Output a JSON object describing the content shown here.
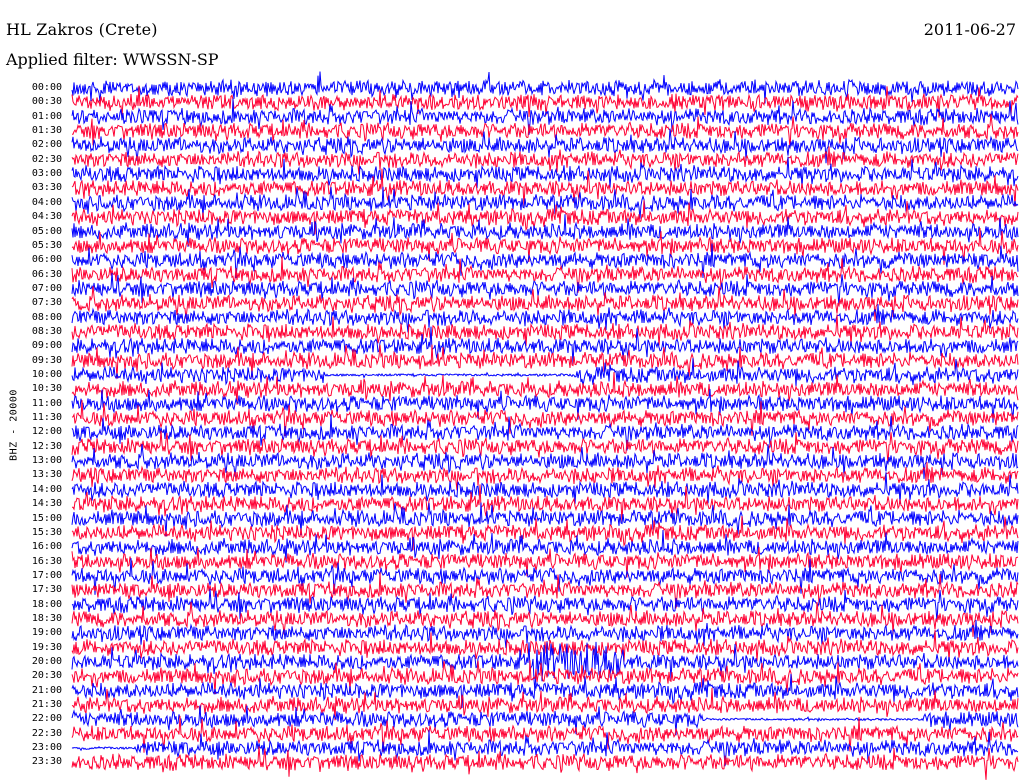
{
  "header": {
    "station": "HL Zakros (Crete)",
    "date": "2011-06-27",
    "filter": "Applied filter: WWSSN-SP"
  },
  "channel_label": "BHZ - 20000",
  "chart_data": {
    "type": "line",
    "subtype": "helicorder",
    "trace_colors": [
      "#0000ff",
      "#ff0033"
    ],
    "row_labels": [
      "00:00",
      "00:30",
      "01:00",
      "01:30",
      "02:00",
      "02:30",
      "03:00",
      "03:30",
      "04:00",
      "04:30",
      "05:00",
      "05:30",
      "06:00",
      "06:30",
      "07:00",
      "07:30",
      "08:00",
      "08:30",
      "09:00",
      "09:30",
      "10:00",
      "10:30",
      "11:00",
      "11:30",
      "12:00",
      "12:30",
      "13:00",
      "13:30",
      "14:00",
      "14:30",
      "15:00",
      "15:30",
      "16:00",
      "16:30",
      "17:00",
      "17:30",
      "18:00",
      "18:30",
      "19:00",
      "19:30",
      "20:00",
      "20:30",
      "21:00",
      "21:30",
      "22:00",
      "22:30",
      "23:00",
      "23:30"
    ],
    "minutes_per_row": 30,
    "grid": false,
    "legend": "none",
    "quiet_intervals": [
      {
        "row": "10:00",
        "from_min": 8.0,
        "to_min": 16.0
      },
      {
        "row": "22:00",
        "from_min": 20.0,
        "to_min": 27.0
      },
      {
        "row": "23:00",
        "from_min": 0.0,
        "to_min": 2.0
      }
    ],
    "burst_intervals": [
      {
        "row": "20:00",
        "from_min": 14.5,
        "to_min": 17.5
      }
    ]
  }
}
